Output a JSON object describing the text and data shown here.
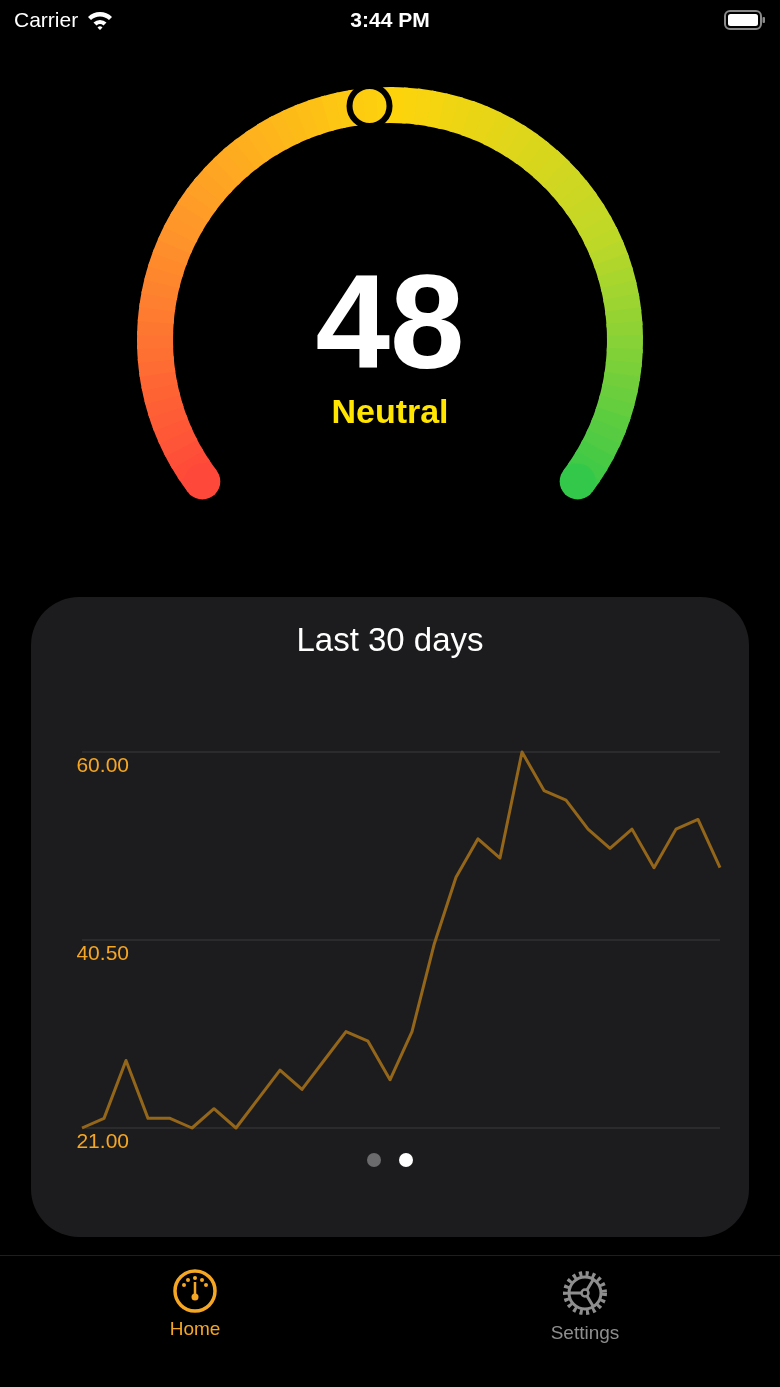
{
  "status_bar": {
    "carrier": "Carrier",
    "time": "3:44 PM"
  },
  "gauge": {
    "value": "48",
    "label": "Neutral"
  },
  "card": {
    "title": "Last 30 days",
    "chart_data": {
      "type": "line",
      "ylim": [
        21,
        60
      ],
      "yticks": [
        {
          "value": 21,
          "label": "21.00"
        },
        {
          "value": 40.5,
          "label": "40.50"
        },
        {
          "value": 60,
          "label": "60.00"
        }
      ],
      "series": [
        {
          "color": "#94661a",
          "values": [
            21,
            22,
            28,
            22,
            22,
            21,
            23,
            21,
            24,
            27,
            25,
            28,
            31,
            30,
            26,
            31,
            40,
            47,
            51,
            49,
            60,
            56,
            55,
            52,
            50,
            52,
            48,
            52,
            53,
            48
          ]
        }
      ]
    },
    "pager": [
      {
        "selected": false
      },
      {
        "selected": true
      }
    ]
  },
  "tabs": [
    {
      "label": "Home",
      "selected": true
    },
    {
      "label": "Settings",
      "selected": false
    }
  ]
}
